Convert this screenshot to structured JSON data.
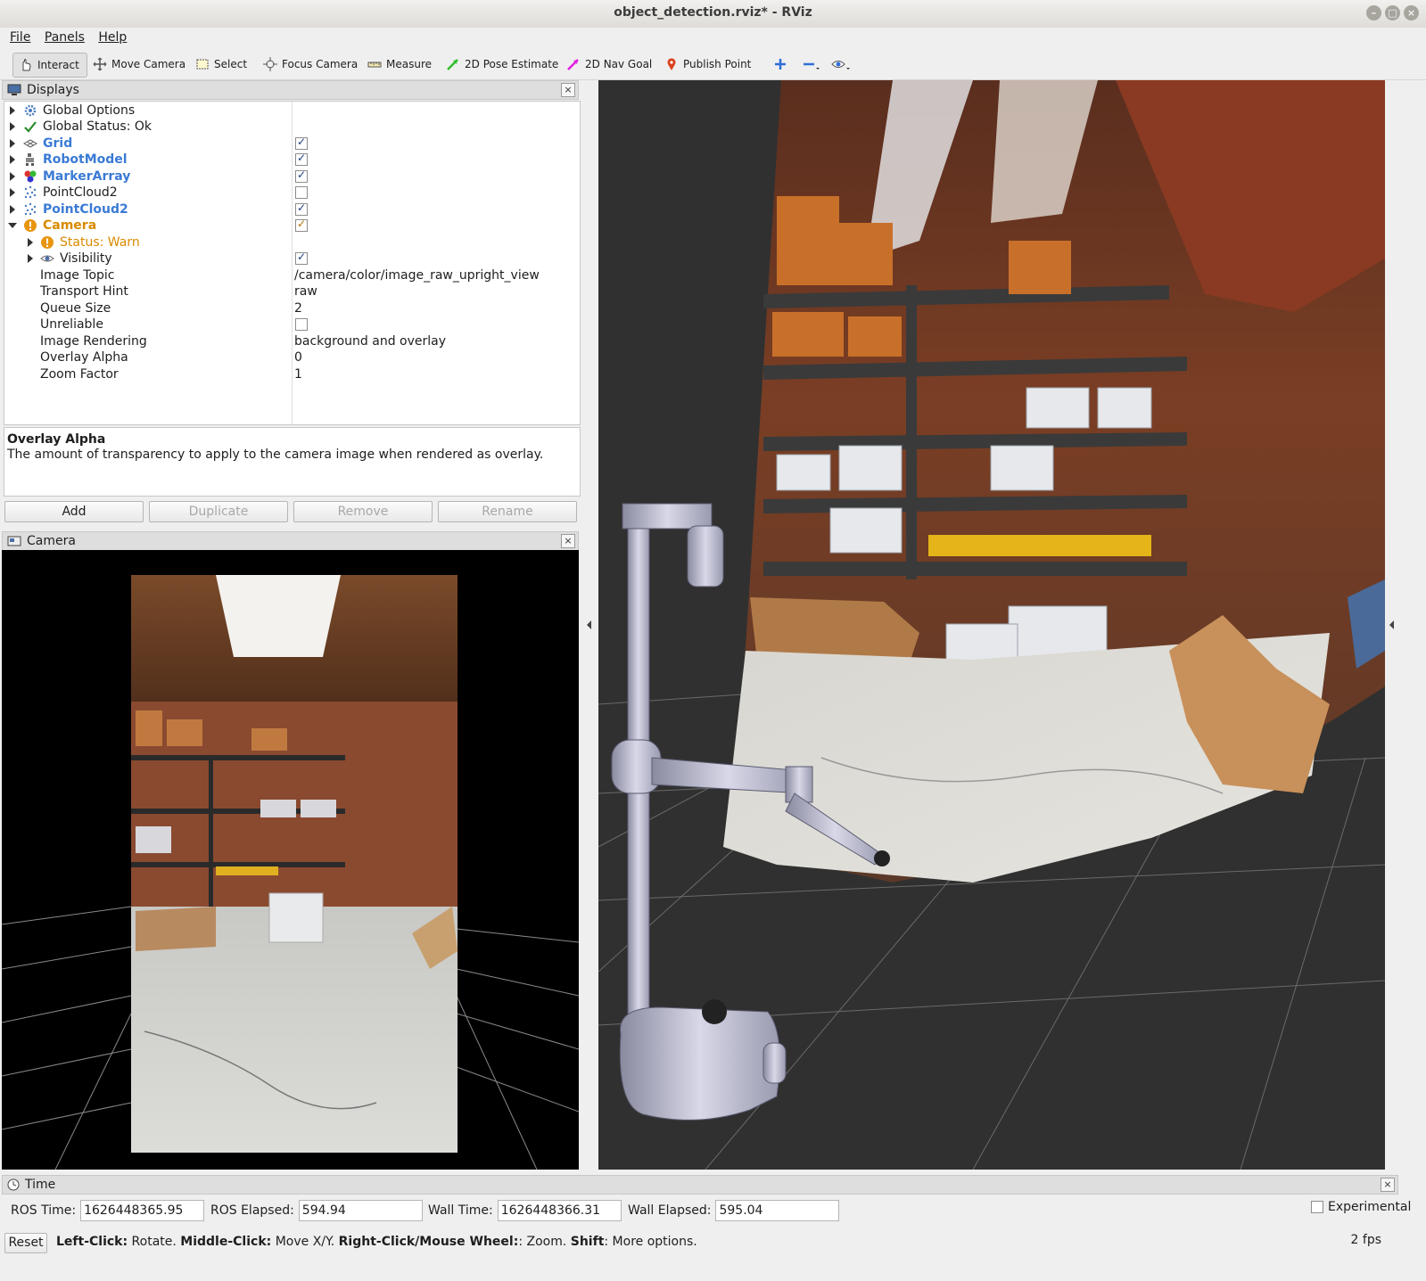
{
  "window": {
    "title": "object_detection.rviz* - RViz"
  },
  "menu": {
    "file": "File",
    "panels": "Panels",
    "help": "Help"
  },
  "toolbar": {
    "interact": "Interact",
    "move_camera": "Move Camera",
    "select": "Select",
    "focus_camera": "Focus Camera",
    "measure": "Measure",
    "pose_estimate": "2D Pose Estimate",
    "nav_goal": "2D Nav Goal",
    "publish_point": "Publish Point"
  },
  "displays": {
    "title": "Displays",
    "items": [
      {
        "label": "Global Options",
        "icon": "gear-icon"
      },
      {
        "label": "Global Status: Ok",
        "icon": "check-icon"
      },
      {
        "label": "Grid",
        "icon": "grid-icon",
        "checked": true
      },
      {
        "label": "RobotModel",
        "icon": "robot-icon",
        "checked": true
      },
      {
        "label": "MarkerArray",
        "icon": "marker-icon",
        "checked": true
      },
      {
        "label": "PointCloud2",
        "icon": "pointcloud-icon",
        "checked": false
      },
      {
        "label": "PointCloud2",
        "icon": "pointcloud-icon",
        "checked": true
      },
      {
        "label": "Camera",
        "icon": "warning-icon",
        "checked": true
      }
    ],
    "camera_props": {
      "status": "Status: Warn",
      "visibility": "Visibility",
      "image_topic_label": "Image Topic",
      "image_topic": "/camera/color/image_raw_upright_view",
      "transport_hint_label": "Transport Hint",
      "transport_hint": "raw",
      "queue_size_label": "Queue Size",
      "queue_size": "2",
      "unreliable_label": "Unreliable",
      "image_rendering_label": "Image Rendering",
      "image_rendering": "background and overlay",
      "overlay_alpha_label": "Overlay Alpha",
      "overlay_alpha": "0",
      "zoom_factor_label": "Zoom Factor",
      "zoom_factor": "1"
    },
    "description": {
      "title": "Overlay Alpha",
      "text": "The amount of transparency to apply to the camera image when rendered as overlay."
    },
    "buttons": {
      "add": "Add",
      "duplicate": "Duplicate",
      "remove": "Remove",
      "rename": "Rename"
    }
  },
  "camera_panel": {
    "title": "Camera"
  },
  "time_panel": {
    "title": "Time",
    "ros_time_label": "ROS Time:",
    "ros_time": "1626448365.95",
    "ros_elapsed_label": "ROS Elapsed:",
    "ros_elapsed": "594.94",
    "wall_time_label": "Wall Time:",
    "wall_time": "1626448366.31",
    "wall_elapsed_label": "Wall Elapsed:",
    "wall_elapsed": "595.04",
    "experimental": "Experimental"
  },
  "status": {
    "reset": "Reset",
    "left_click": "Left-Click:",
    "left_click_desc": " Rotate. ",
    "middle_click": "Middle-Click:",
    "middle_click_desc": " Move X/Y. ",
    "right_click": "Right-Click/Mouse Wheel:",
    "right_click_desc": ": Zoom. ",
    "shift": "Shift",
    "shift_desc": ": More options.",
    "fps": "2 fps"
  },
  "colors": {
    "link_blue": "#3a7bd5",
    "warn_orange": "#d98a00",
    "viewport_bg": "#303030"
  }
}
